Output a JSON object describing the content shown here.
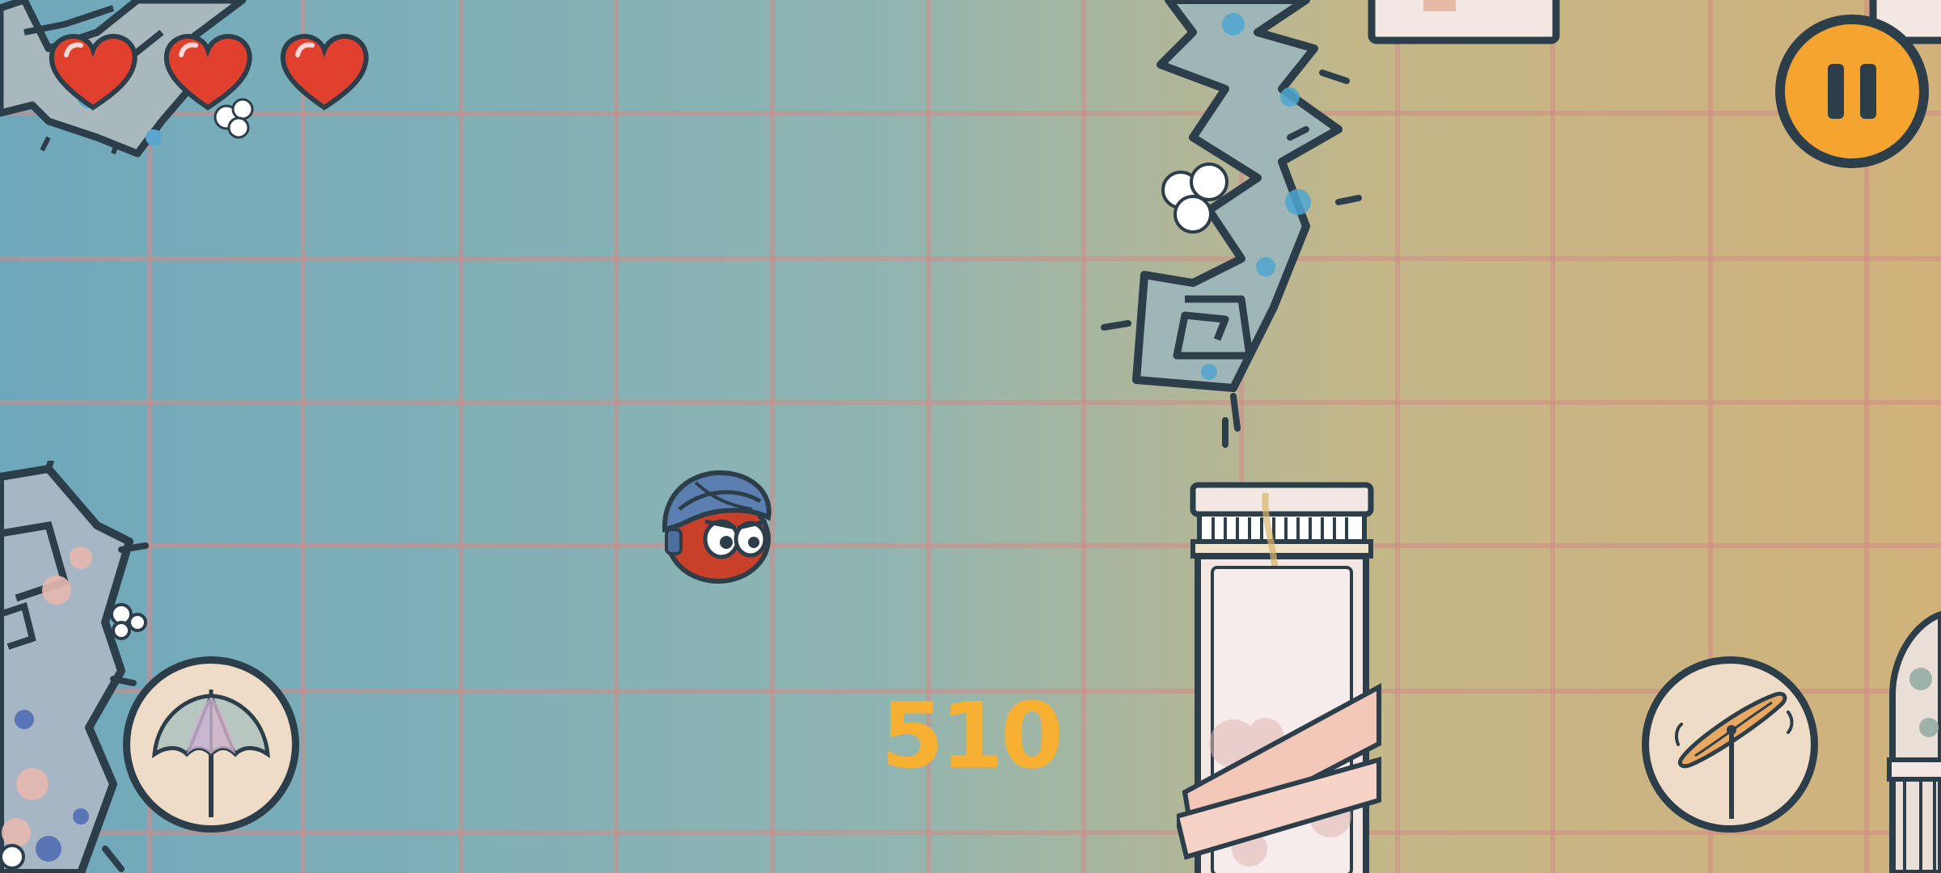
{
  "hud": {
    "lives": 3,
    "score": "510"
  },
  "controls": {
    "pause_icon": "pause-icon",
    "umbrella_icon": "umbrella-icon",
    "propeller_icon": "propeller-icon"
  },
  "colors": {
    "bg_left": "#6fa9bd",
    "bg_right": "#cfb37a",
    "grid_line": "#d48d88",
    "outline": "#2d3e4b",
    "heart": "#e2402f",
    "pause_fill": "#f4a530",
    "score": "#f7b032",
    "ability_fill": "#efdcc6",
    "player_red": "#c8402a",
    "helmet_blue": "#5a7fb0"
  }
}
